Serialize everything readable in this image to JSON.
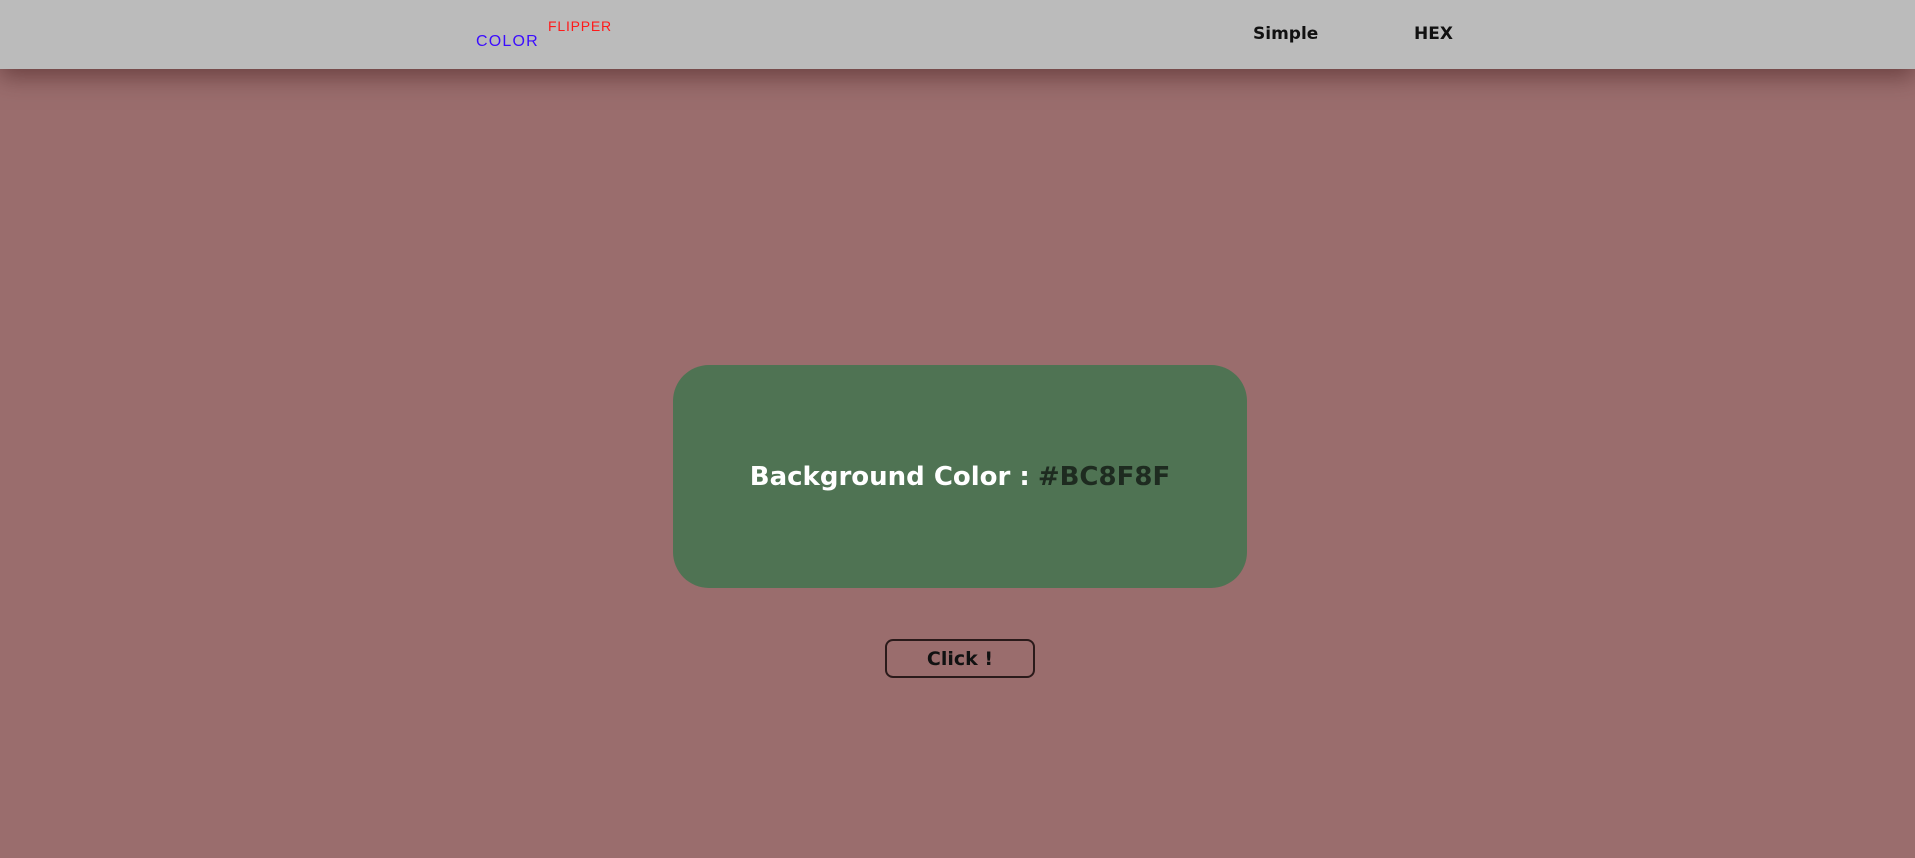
{
  "brand": {
    "word1": "COLOR",
    "word2": "FLIPPER",
    "word1_color": "#3b0cff",
    "word2_color": "#ff1a1a"
  },
  "nav": {
    "links": [
      {
        "label": "Simple"
      },
      {
        "label": "HEX"
      }
    ]
  },
  "main": {
    "label": "Background Color :",
    "value": "#BC8F8F",
    "card_color": "#4f7353",
    "page_background": "#9a6d6d"
  },
  "button": {
    "label": "Click !"
  }
}
